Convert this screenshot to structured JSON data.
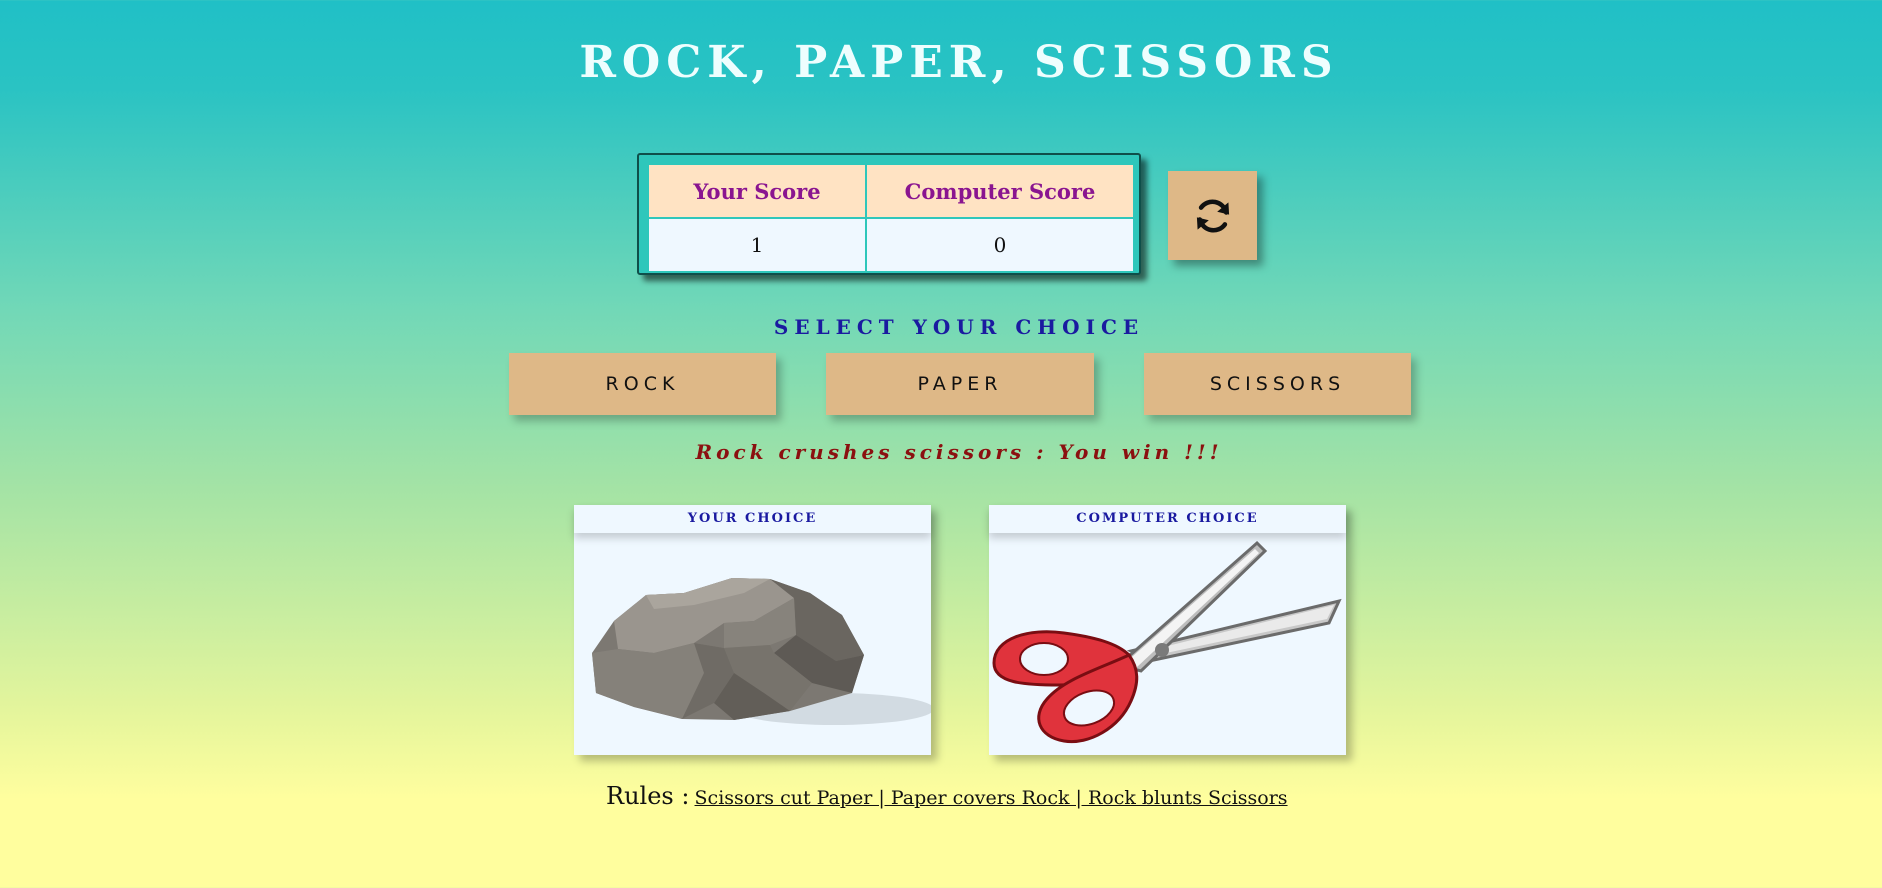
{
  "title": "ROCK, PAPER, SCISSORS",
  "scoreboard": {
    "your_score_label": "Your Score",
    "computer_score_label": "Computer Score",
    "your_score": "1",
    "computer_score": "0"
  },
  "refresh": {
    "icon": "refresh-icon"
  },
  "select_label": "SELECT YOUR CHOICE",
  "choices": {
    "rock": "ROCK",
    "paper": "PAPER",
    "scissors": "SCISSORS"
  },
  "result": "Rock crushes scissors : You win !!!",
  "your_choice": {
    "label": "YOUR CHOICE",
    "image": "rock-image"
  },
  "computer_choice": {
    "label": "COMPUTER CHOICE",
    "image": "scissors-image"
  },
  "rules": {
    "label": "Rules :",
    "text": "Scissors cut Paper | Paper covers Rock | Rock blunts Scissors"
  },
  "colors": {
    "button_bg": "#deb887",
    "score_header_text": "#8a1590",
    "result_text": "#8b1010",
    "select_text": "#1a1aa0"
  }
}
